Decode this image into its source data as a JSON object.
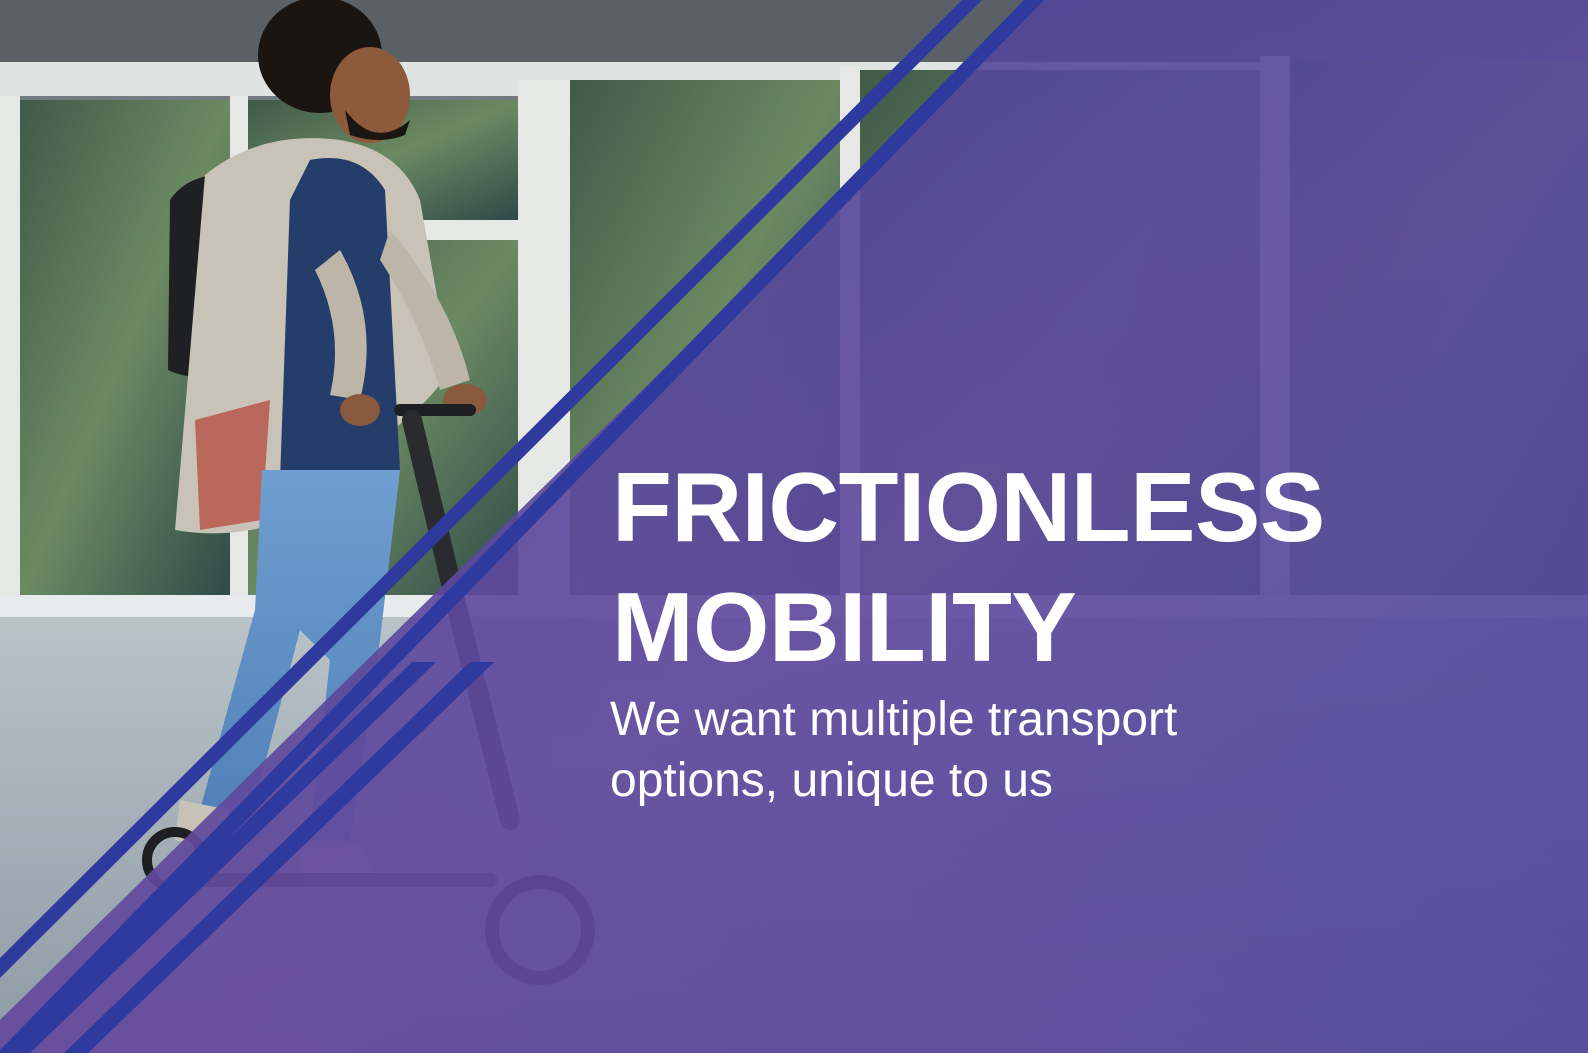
{
  "hero": {
    "headline_line1": "FRICTIONLESS",
    "headline_line2": "MOBILITY",
    "subhead_line1": "We want multiple transport",
    "subhead_line2": "options, unique to us"
  },
  "colors": {
    "overlay_top": "#4b3f9a",
    "overlay_bottom": "#6a4a9c",
    "stripe": "#2e3a9e",
    "text": "#ffffff"
  },
  "photo": {
    "subject": "man riding an electric kick scooter past a glass building"
  }
}
